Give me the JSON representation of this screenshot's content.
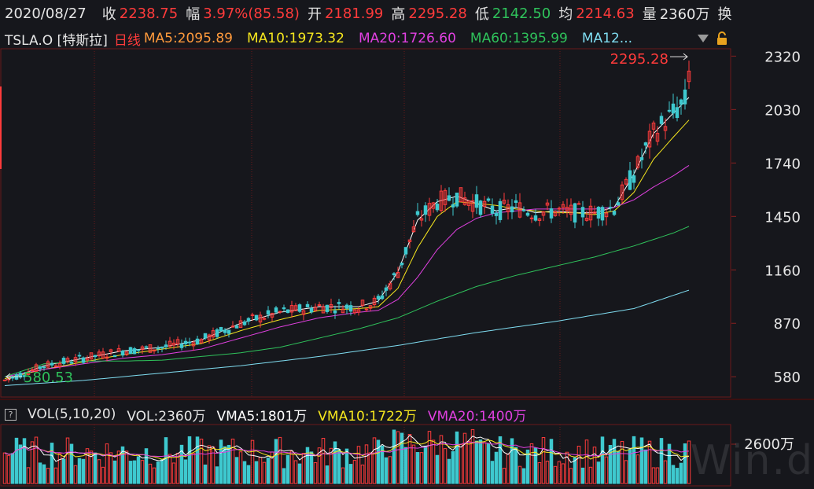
{
  "header": {
    "date": "2020/08/27",
    "close_label": "收",
    "close_value": "2238.75",
    "change_label": "幅",
    "change_value": "3.97%(85.58)",
    "open_label": "开",
    "open_value": "2181.99",
    "high_label": "高",
    "high_value": "2295.28",
    "low_label": "低",
    "low_value": "2142.50",
    "avg_label": "均",
    "avg_value": "2214.63",
    "volume_label": "量",
    "volume_value": "2360万",
    "turnover_label": "换"
  },
  "legend": {
    "symbol": "TSLA.O [特斯拉]",
    "period": "日线",
    "ma5": "MA5:2095.89",
    "ma10": "MA10:1973.32",
    "ma20": "MA20:1726.60",
    "ma60": "MA60:1395.99",
    "ma120": "MA12..."
  },
  "volume_legend": {
    "title": "VOL(5,10,20)",
    "vol": "VOL:2360万",
    "vma5": "VMA5:1801万",
    "vma10": "VMA10:1722万",
    "vma20": "VMA20:1400万",
    "axis_label": "2600万"
  },
  "watermark": "Win.d",
  "colors": {
    "up": "#ff3b3b",
    "down": "#3ec9cf",
    "ma5": "#ffffff",
    "ma10": "#f5e61e",
    "ma20": "#e040e0",
    "ma60": "#2fc25b",
    "ma120": "#7fdcf0",
    "grid": "#6b1a1a",
    "bg": "#16171c"
  },
  "chart_data": {
    "type": "candlestick",
    "price_axis": {
      "ticks": [
        580,
        870,
        1160,
        1450,
        1740,
        2030,
        2320
      ],
      "ylim": [
        470,
        2360
      ]
    },
    "annotations": {
      "max_label": "2295.28",
      "min_label": "580.53"
    },
    "days": 130,
    "ma_series": [
      {
        "name": "MA5",
        "anchors": [
          [
            0,
            560
          ],
          [
            10,
            640
          ],
          [
            20,
            680
          ],
          [
            30,
            720
          ],
          [
            40,
            740
          ],
          [
            50,
            780
          ],
          [
            60,
            870
          ],
          [
            70,
            930
          ],
          [
            80,
            960
          ],
          [
            90,
            960
          ],
          [
            95,
            990
          ],
          [
            100,
            1150
          ],
          [
            105,
            1430
          ],
          [
            110,
            1530
          ],
          [
            115,
            1560
          ],
          [
            120,
            1520
          ],
          [
            125,
            1480
          ],
          [
            130,
            1500
          ],
          [
            135,
            1470
          ],
          [
            140,
            1480
          ],
          [
            145,
            1470
          ],
          [
            150,
            1470
          ],
          [
            155,
            1500
          ],
          [
            160,
            1680
          ],
          [
            165,
            1900
          ],
          [
            170,
            2010
          ],
          [
            174,
            2096
          ]
        ]
      },
      {
        "name": "MA10",
        "anchors": [
          [
            0,
            570
          ],
          [
            10,
            620
          ],
          [
            20,
            660
          ],
          [
            30,
            700
          ],
          [
            40,
            730
          ],
          [
            50,
            760
          ],
          [
            60,
            830
          ],
          [
            70,
            890
          ],
          [
            80,
            940
          ],
          [
            90,
            950
          ],
          [
            95,
            960
          ],
          [
            100,
            1060
          ],
          [
            105,
            1280
          ],
          [
            110,
            1450
          ],
          [
            115,
            1530
          ],
          [
            120,
            1520
          ],
          [
            125,
            1510
          ],
          [
            130,
            1490
          ],
          [
            135,
            1480
          ],
          [
            140,
            1470
          ],
          [
            145,
            1470
          ],
          [
            150,
            1460
          ],
          [
            155,
            1480
          ],
          [
            160,
            1580
          ],
          [
            165,
            1760
          ],
          [
            170,
            1880
          ],
          [
            174,
            1973
          ]
        ]
      },
      {
        "name": "MA20",
        "anchors": [
          [
            0,
            580
          ],
          [
            10,
            620
          ],
          [
            20,
            650
          ],
          [
            30,
            680
          ],
          [
            40,
            700
          ],
          [
            50,
            730
          ],
          [
            60,
            790
          ],
          [
            70,
            850
          ],
          [
            80,
            900
          ],
          [
            90,
            930
          ],
          [
            95,
            940
          ],
          [
            100,
            1000
          ],
          [
            105,
            1120
          ],
          [
            110,
            1270
          ],
          [
            115,
            1380
          ],
          [
            120,
            1440
          ],
          [
            125,
            1470
          ],
          [
            130,
            1480
          ],
          [
            135,
            1490
          ],
          [
            140,
            1490
          ],
          [
            145,
            1490
          ],
          [
            150,
            1490
          ],
          [
            155,
            1500
          ],
          [
            160,
            1540
          ],
          [
            165,
            1610
          ],
          [
            170,
            1670
          ],
          [
            174,
            1727
          ]
        ]
      },
      {
        "name": "MA60",
        "anchors": [
          [
            0,
            580
          ],
          [
            10,
            650
          ],
          [
            20,
            665
          ],
          [
            30,
            665
          ],
          [
            40,
            670
          ],
          [
            50,
            690
          ],
          [
            60,
            710
          ],
          [
            70,
            740
          ],
          [
            80,
            790
          ],
          [
            90,
            840
          ],
          [
            100,
            900
          ],
          [
            110,
            990
          ],
          [
            120,
            1070
          ],
          [
            130,
            1130
          ],
          [
            140,
            1180
          ],
          [
            150,
            1230
          ],
          [
            160,
            1290
          ],
          [
            170,
            1360
          ],
          [
            174,
            1396
          ]
        ]
      },
      {
        "name": "MA120",
        "anchors": [
          [
            0,
            532
          ],
          [
            20,
            560
          ],
          [
            40,
            600
          ],
          [
            60,
            640
          ],
          [
            80,
            690
          ],
          [
            100,
            750
          ],
          [
            120,
            820
          ],
          [
            140,
            880
          ],
          [
            160,
            950
          ],
          [
            174,
            1050
          ]
        ]
      }
    ]
  }
}
